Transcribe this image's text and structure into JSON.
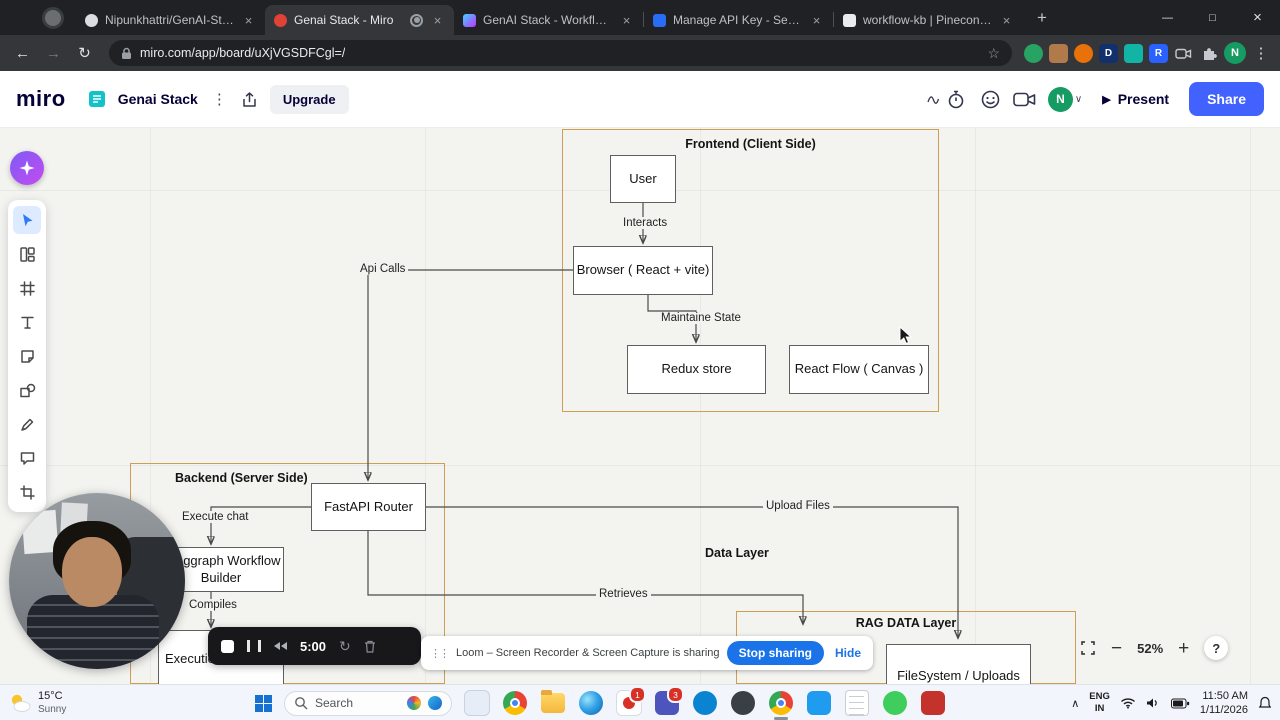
{
  "colors": {
    "miro_blue": "#4262ff",
    "stop_sharing_blue": "#1a73e8",
    "container_border": "#cf9e55",
    "avatar_green": "#169b62",
    "record_red": "#e04235"
  },
  "icons": {
    "back": "←",
    "forward": "→",
    "reload": "↻",
    "star": "☆",
    "kebab": "⋮",
    "grip": "⋮⋮",
    "new_tab": "+",
    "minimize": "—",
    "maximize": "□",
    "close": "×",
    "chevron_down": "∨",
    "chevron_up": "∧",
    "play": "▶",
    "zoom_out": "−",
    "zoom_in": "+",
    "help": "?"
  },
  "browser": {
    "tabs": [
      {
        "title": "Nipunkhattri/GenAI-Stack-W..."
      },
      {
        "title": "Genai Stack - Miro"
      },
      {
        "title": "GenAI Stack - Workflow Builder"
      },
      {
        "title": "Manage API Key - SerpApi"
      },
      {
        "title": "workflow-kb | Pinecone Consol..."
      }
    ],
    "nav": {
      "url": "miro.com/app/board/uXjVGSDFCgl=/",
      "profile_initial": "N",
      "extensions": {
        "d_label": "D",
        "r_label": "R"
      }
    }
  },
  "miro": {
    "logo": "miro",
    "board_title": "Genai Stack",
    "upgrade": "Upgrade",
    "present": "Present",
    "share": "Share",
    "avatar_initial": "N",
    "zoom_level": "52%"
  },
  "diagram": {
    "containers": [
      {
        "label": "Frontend (Client Side)"
      },
      {
        "label": "Backend (Server Side)"
      },
      {
        "label": "RAG DATA Layer"
      }
    ],
    "section_labels": [
      {
        "text": "Data Layer"
      }
    ],
    "nodes": [
      {
        "label": "User"
      },
      {
        "label": "Browser ( React + vite)"
      },
      {
        "label": "Redux store"
      },
      {
        "label": "React Flow ( Canvas )"
      },
      {
        "label": "FastAPI Router"
      },
      {
        "label": "Langgraph Workflow Builder"
      },
      {
        "label": "Execution"
      },
      {
        "label": "FileSystem / Uploads"
      }
    ],
    "edge_labels": [
      {
        "text": "Interacts"
      },
      {
        "text": "Maintaine State"
      },
      {
        "text": "Api Calls"
      },
      {
        "text": "Execute chat"
      },
      {
        "text": "Compiles"
      },
      {
        "text": "Upload Files"
      },
      {
        "text": "Retrieves"
      }
    ]
  },
  "loom": {
    "timer": "5:00",
    "banner_text": "Loom – Screen Recorder & Screen Capture is sharing your screen.",
    "stop_sharing": "Stop sharing",
    "hide": "Hide"
  },
  "taskbar": {
    "weather": {
      "temp": "15°C",
      "condition": "Sunny"
    },
    "search_label": "Search",
    "badges": {
      "mail": "1",
      "teams": "3"
    },
    "tray": {
      "lang_top": "ENG",
      "lang_bottom": "IN",
      "time": "11:50 AM",
      "date": "1/11/2026"
    }
  }
}
